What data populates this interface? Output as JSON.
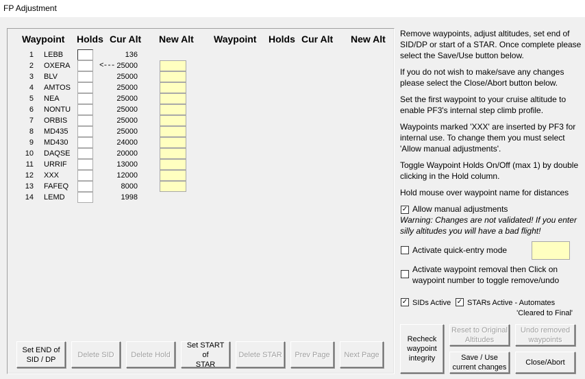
{
  "window": {
    "title": "FP Adjustment"
  },
  "columns": {
    "left": {
      "waypoint": "Waypoint",
      "holds": "Holds",
      "cur_alt": "Cur Alt",
      "new_alt": "New Alt"
    },
    "right": {
      "waypoint": "Waypoint",
      "holds": "Holds",
      "cur_alt": "Cur Alt",
      "new_alt": "New Alt"
    }
  },
  "waypoints": [
    {
      "num": "1",
      "name": "LEBB",
      "cur_alt": "136"
    },
    {
      "num": "2",
      "name": "OXERA",
      "cur_alt": "25000"
    },
    {
      "num": "3",
      "name": "BLV",
      "cur_alt": "25000"
    },
    {
      "num": "4",
      "name": "AMTOS",
      "cur_alt": "25000"
    },
    {
      "num": "5",
      "name": "NEA",
      "cur_alt": "25000"
    },
    {
      "num": "6",
      "name": "NONTU",
      "cur_alt": "25000"
    },
    {
      "num": "7",
      "name": "ORBIS",
      "cur_alt": "25000"
    },
    {
      "num": "8",
      "name": "MD435",
      "cur_alt": "25000"
    },
    {
      "num": "9",
      "name": "MD430",
      "cur_alt": "24000"
    },
    {
      "num": "10",
      "name": "DAQSE",
      "cur_alt": "20000"
    },
    {
      "num": "11",
      "name": "URRIF",
      "cur_alt": "13000"
    },
    {
      "num": "12",
      "name": "XXX",
      "cur_alt": "12000"
    },
    {
      "num": "13",
      "name": "FAFEQ",
      "cur_alt": "8000"
    },
    {
      "num": "14",
      "name": "LEMD",
      "cur_alt": "1998"
    }
  ],
  "arrow_marker": "<---",
  "info": {
    "p1": "Remove waypoints, adjust altitudes, set end of SID/DP or start of a STAR. Once complete please select the Save/Use button below.",
    "p2": "If you do not wish to make/save any changes please select the Close/Abort button below.",
    "p3": "Set the first waypoint to your cruise altitude to enable PF3's internal step climb profile.",
    "p4": "Waypoints marked 'XXX' are inserted by PF3 for internal use. To change them you must select 'Allow manual adjustments'.",
    "p5": "Toggle Waypoint Holds On/Off (max 1) by double clicking in the Hold column.",
    "p6": "Hold mouse over waypoint name for distances"
  },
  "options": {
    "allow_manual": {
      "label": "Allow manual adjustments",
      "checked": "✓"
    },
    "warning": "Warning: Changes are not validated! If you enter silly altitudes you will have a bad flight!",
    "quick_entry": {
      "label": "Activate quick-entry mode",
      "value": ""
    },
    "removal": {
      "label": "Activate waypoint removal then Click on waypoint number to toggle remove/undo"
    },
    "sids": {
      "label": "SIDs Active",
      "checked": "✓"
    },
    "stars": {
      "label": "STARs Active - Automates",
      "checked": "✓"
    },
    "cleared": "'Cleared to Final'"
  },
  "buttons": {
    "set_end_sid": "Set END of\nSID / DP",
    "delete_sid": "Delete SID",
    "delete_hold": "Delete Hold",
    "set_start_star": "Set START of\nSTAR",
    "delete_star": "Delete STAR",
    "prev_page": "Prev Page",
    "next_page": "Next Page",
    "recheck": "Recheck\nwaypoint\nintegrity",
    "reset": "Reset to Original\nAltitudes",
    "undo_removed": "Undo removed\nwaypoints",
    "save_use": "Save / Use\ncurrent changes",
    "close_abort": "Close/Abort"
  }
}
